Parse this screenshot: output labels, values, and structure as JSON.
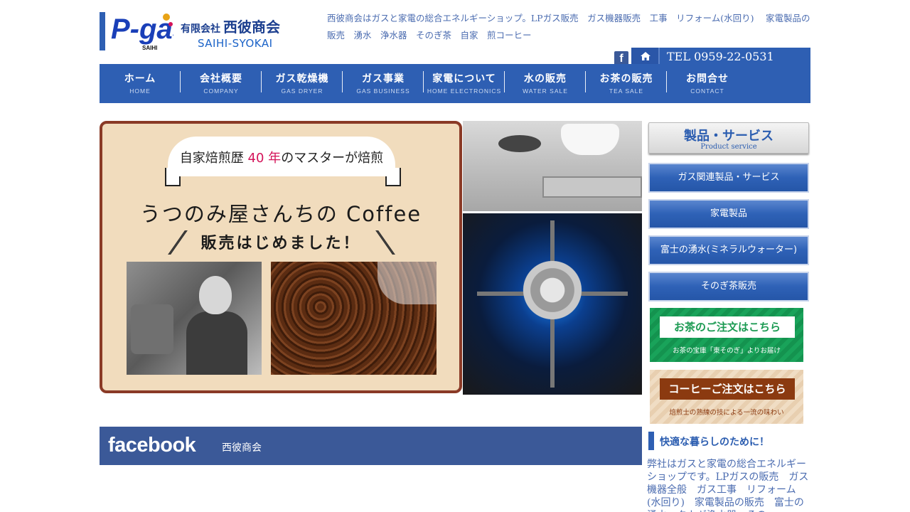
{
  "header": {
    "company_type": "有限会社",
    "company_name": "西彼商会",
    "company_en": "SAIHI-SYOKAI",
    "logo_text": "P-gas",
    "logo_sub": "SAIHI",
    "tagline": "西彼商会はガスと家電の総合エネルギーショップ。LPガス販売　ガス機器販売　工事　リフォーム(水回り)　 家電製品の販売　湧水　浄水器　そのぎ茶　自家　煎コーヒー",
    "facebook_icon": "f",
    "tel": "TEL 0959-22-0531"
  },
  "nav": [
    {
      "jp": "ホーム",
      "en": "HOME"
    },
    {
      "jp": "会社概要",
      "en": "COMPANY"
    },
    {
      "jp": "ガス乾燥機",
      "en": "GAS DRYER"
    },
    {
      "jp": "ガス事業",
      "en": "GAS BUSINESS"
    },
    {
      "jp": "家電について",
      "en": "HOME ELECTRONICS"
    },
    {
      "jp": "水の販売",
      "en": "WATER SALE"
    },
    {
      "jp": "お茶の販売",
      "en": "TEA SALE"
    },
    {
      "jp": "お問合せ",
      "en": "CONTACT"
    }
  ],
  "banner": {
    "ribbon_pre": "自家焙煎歴",
    "ribbon_num": "40 年",
    "ribbon_post": "のマスターが焙煎",
    "title": "うつのみ屋さんちの Coffee",
    "subtitle": "販売はじめました！"
  },
  "facebook_bar": {
    "logo": "facebook",
    "page_name": "西彼商会"
  },
  "sidebar": {
    "heading_jp": "製品・サービス",
    "heading_en": "Product service",
    "buttons": [
      "ガス関連製品・サービス",
      "家電製品",
      "富士の湧水(ミネラルウォーター)",
      "そのぎ茶販売"
    ],
    "tea_order": {
      "title": "お茶のご注文はこちら",
      "sub": "お茶の宝庫「東そのぎ」よりお届け"
    },
    "coffee_order": {
      "title": "コーヒーご注文はこちら",
      "sub": "焙煎士の熟練の技による一流の味わい"
    },
    "section_title": "快適な暮らしのために！",
    "section_text": "弊社はガスと家電の総合エネルギーショップです。LPガスの販売　ガス機器全般　ガス工事　リフォーム(水回り)　家電製品の販売　富士の湧水　タカギ浄水器　その"
  },
  "colors": {
    "brand_blue": "#2e5fb3",
    "facebook_blue": "#3b5998",
    "banner_border": "#8a3a26",
    "tea_green": "#19a35a",
    "coffee_brown": "#8b3a10"
  }
}
